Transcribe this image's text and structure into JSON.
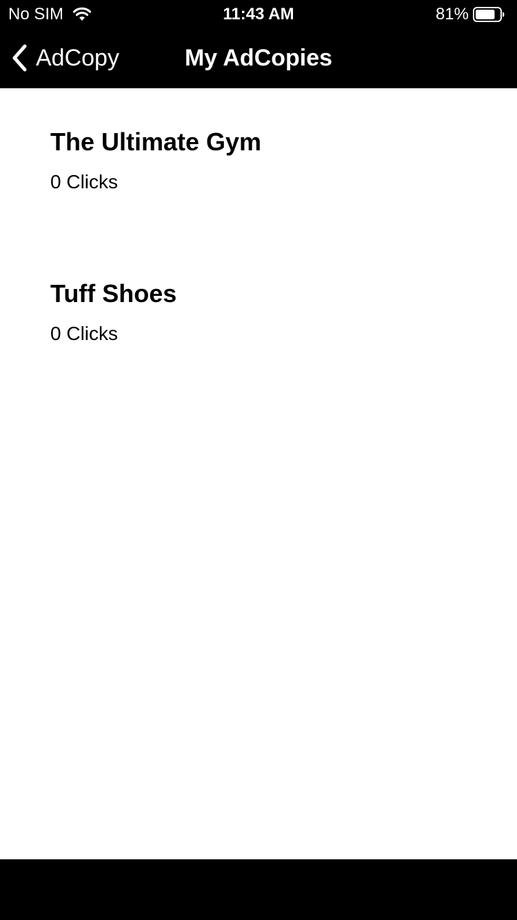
{
  "status_bar": {
    "carrier": "No SIM",
    "time": "11:43 AM",
    "battery_percent": "81%",
    "battery_level": 0.81,
    "wifi_icon": "wifi-icon",
    "battery_icon": "battery-icon"
  },
  "nav": {
    "back_label": "AdCopy",
    "back_icon": "chevron-left-icon",
    "title": "My AdCopies"
  },
  "ads": [
    {
      "title": "The Ultimate Gym",
      "clicks": "0 Clicks"
    },
    {
      "title": "Tuff Shoes",
      "clicks": "0 Clicks"
    }
  ],
  "colors": {
    "bar_background": "#000000",
    "bar_text": "#ffffff",
    "content_background": "#ffffff",
    "content_text": "#000000"
  }
}
